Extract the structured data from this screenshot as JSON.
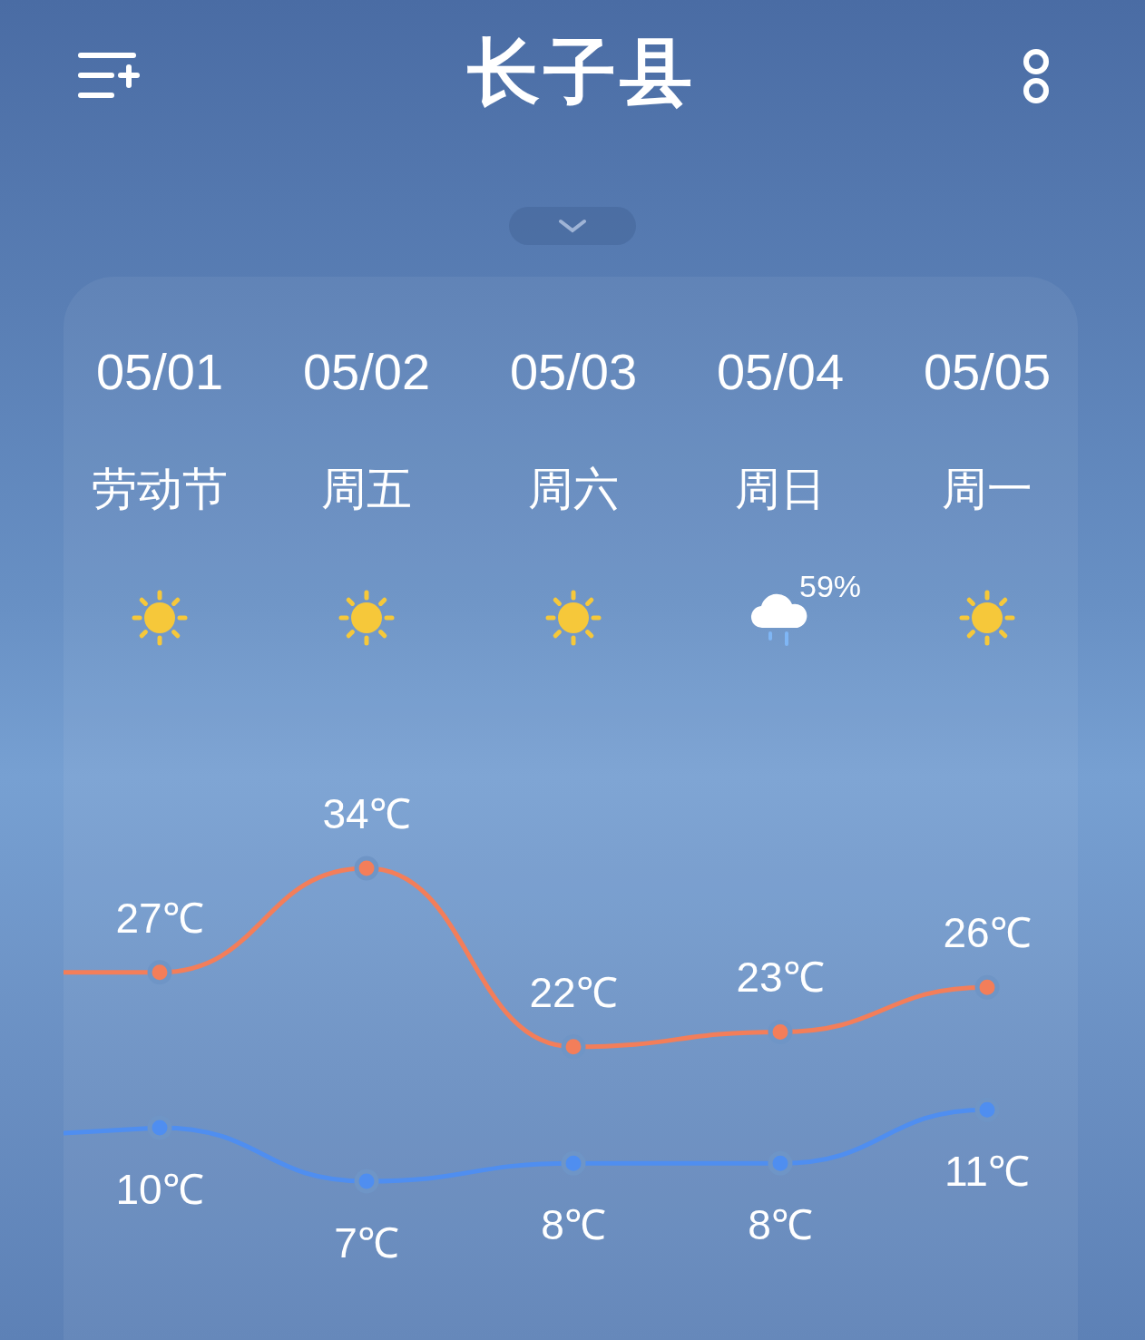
{
  "header": {
    "title": "长子县"
  },
  "forecast": {
    "days": [
      {
        "date": "05/01",
        "label": "劳动节",
        "kind": "sunny",
        "high": "27℃",
        "low": "10℃"
      },
      {
        "date": "05/02",
        "label": "周五",
        "kind": "sunny",
        "high": "34℃",
        "low": "7℃"
      },
      {
        "date": "05/03",
        "label": "周六",
        "kind": "sunny",
        "high": "22℃",
        "low": "8℃"
      },
      {
        "date": "05/04",
        "label": "周日",
        "kind": "rain",
        "precipitation": "59%",
        "high": "23℃",
        "low": "8℃"
      },
      {
        "date": "05/05",
        "label": "周一",
        "kind": "sunny",
        "high": "26℃",
        "low": "11℃"
      }
    ]
  }
}
